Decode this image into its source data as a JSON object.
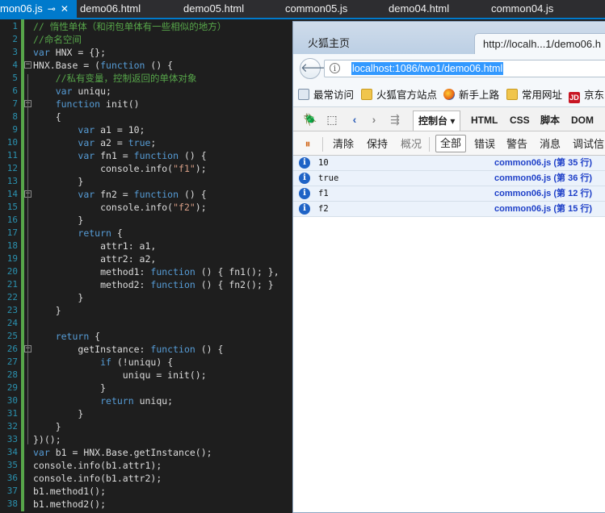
{
  "editor": {
    "tabs": [
      {
        "label": "mon06.js",
        "active": true
      },
      {
        "label": "demo06.html"
      },
      {
        "label": "demo05.html"
      },
      {
        "label": "common05.js"
      },
      {
        "label": "demo04.html"
      },
      {
        "label": "common04.js"
      }
    ],
    "line_numbers": [
      "1",
      "2",
      "3",
      "4",
      "5",
      "6",
      "7",
      "8",
      "9",
      "10",
      "11",
      "12",
      "13",
      "14",
      "15",
      "16",
      "17",
      "18",
      "19",
      "20",
      "21",
      "22",
      "23",
      "24",
      "25",
      "26",
      "27",
      "28",
      "29",
      "30",
      "31",
      "32",
      "33",
      "34",
      "35",
      "36",
      "37",
      "38"
    ],
    "lines": [
      "// 惰性单体（和闭包单体有一些相似的地方）",
      "//命名空间",
      "var HNX = {};",
      "HNX.Base = (function () {",
      "    //私有变量，控制返回的单体对象",
      "    var uniqu;",
      "    function init()",
      "    {",
      "        var a1 = 10;",
      "        var a2 = true;",
      "        var fn1 = function () {",
      "            console.info(\"f1\");",
      "        }",
      "        var fn2 = function () {",
      "            console.info(\"f2\");",
      "        }",
      "        return {",
      "            attr1: a1,",
      "            attr2: a2,",
      "            method1: function () { fn1(); },",
      "            method2: function () { fn2(); }",
      "        }",
      "    }",
      "",
      "    return {",
      "        getInstance: function () {",
      "            if (!uniqu) {",
      "                uniqu = init();",
      "            }",
      "            return uniqu;",
      "        }",
      "    }",
      "})();",
      "var b1 = HNX.Base.getInstance();",
      "console.info(b1.attr1);",
      "console.info(b1.attr2);",
      "b1.method1();",
      "b1.method2();"
    ]
  },
  "browser": {
    "tabs": [
      "火狐主页",
      "http://localh...1/demo06.h"
    ],
    "url": "localhost:1086/two1/demo06.html",
    "bookmarks": [
      "最常访问",
      "火狐官方站点",
      "新手上路",
      "常用网址",
      "京东"
    ],
    "jd_logo": "JD",
    "firebug_tabs": [
      "控制台 ▾",
      "HTML",
      "CSS",
      "脚本",
      "DOM"
    ],
    "filters": [
      "清除",
      "保持",
      "概况",
      "全部",
      "错误",
      "警告",
      "消息",
      "调试信"
    ],
    "console_rows": [
      {
        "message": "10",
        "source": "common06.js (第 35 行)"
      },
      {
        "message": "true",
        "source": "common06.js (第 36 行)"
      },
      {
        "message": "f1",
        "source": "common06.js (第 12 行)"
      },
      {
        "message": "f2",
        "source": "common06.js (第 15 行)"
      }
    ]
  }
}
